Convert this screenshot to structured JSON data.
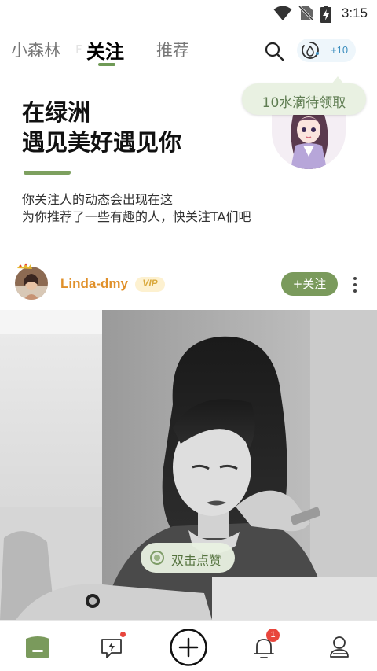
{
  "status_bar": {
    "time": "3:15",
    "icons": [
      "wifi-icon",
      "no-sim-icon",
      "battery-charging-icon"
    ]
  },
  "top_nav": {
    "tabs": [
      {
        "label": "小森林",
        "active": false
      },
      {
        "label": "关注",
        "active": true
      },
      {
        "label": "推荐",
        "active": false
      }
    ],
    "ghost_label": "F  W",
    "search_icon": "search-icon",
    "water_icon": "water-drop-timer-icon",
    "water_bonus": "+10"
  },
  "tooltip": {
    "text": "10水滴待领取"
  },
  "intro": {
    "title_line1": "在绿洲",
    "title_line2": "遇见美好遇见你",
    "desc_line1": "你关注人的动态会出现在这",
    "desc_line2": "为你推荐了一些有趣的人，快关注TA们吧"
  },
  "post": {
    "username": "Linda-dmy",
    "vip_label": "VIP",
    "follow_label": "+关注",
    "more_icon": "more-vertical-icon",
    "like_hint": "双击点赞"
  },
  "bottom_nav": {
    "items": [
      {
        "icon": "home-icon",
        "active": true
      },
      {
        "icon": "message-lightning-icon",
        "dot": true
      },
      {
        "icon": "add-circle-icon"
      },
      {
        "icon": "bell-icon",
        "badge": "1"
      },
      {
        "icon": "profile-icon"
      }
    ]
  },
  "colors": {
    "accent_green": "#7a9a5c",
    "username_orange": "#e0902a",
    "badge_red": "#e8453c",
    "tooltip_bg": "#e9f1e2"
  }
}
